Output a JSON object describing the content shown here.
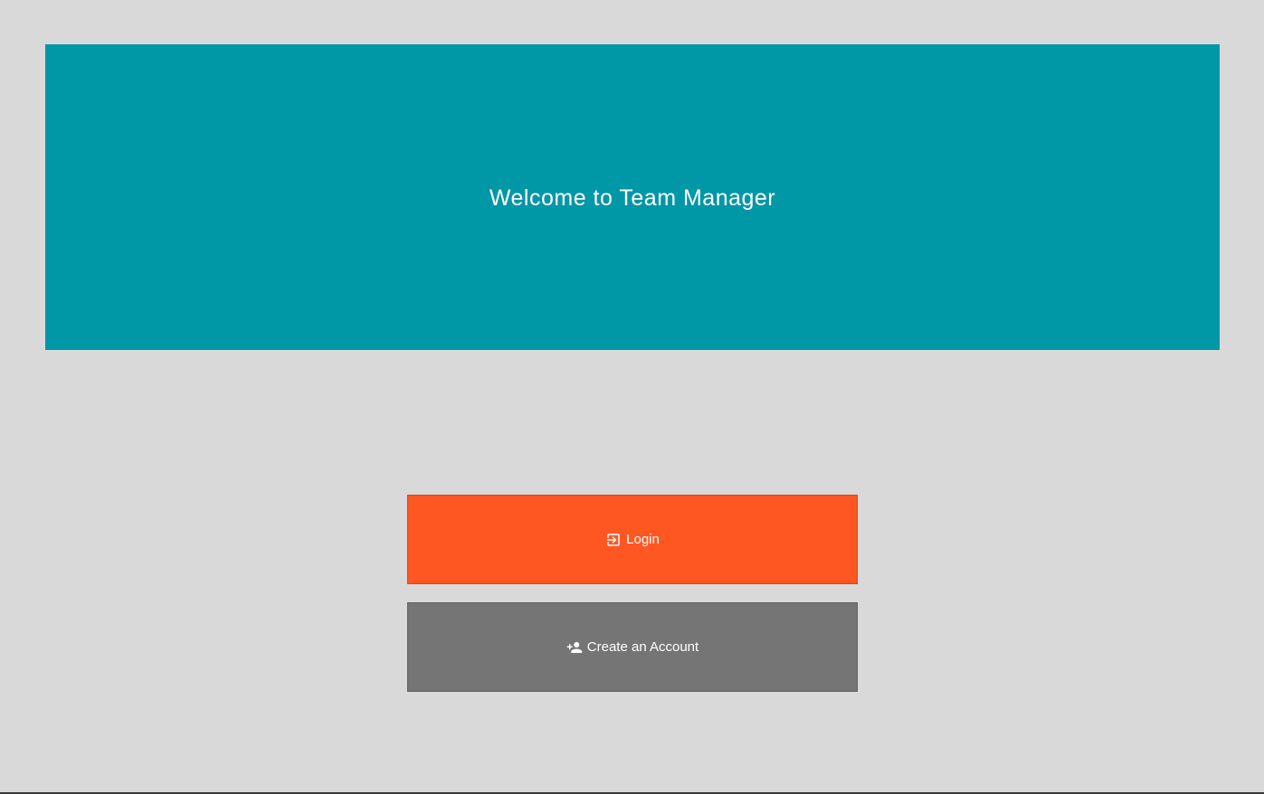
{
  "hero": {
    "title": "Welcome to Team Manager",
    "background_color": "#0097a7"
  },
  "actions": {
    "login": {
      "label": "Login",
      "icon": "login-icon",
      "color": "#ff5722"
    },
    "create_account": {
      "label": "Create an Account",
      "icon": "person-add-icon",
      "color": "#757575"
    }
  },
  "page": {
    "background_color": "#d9d9d9"
  }
}
